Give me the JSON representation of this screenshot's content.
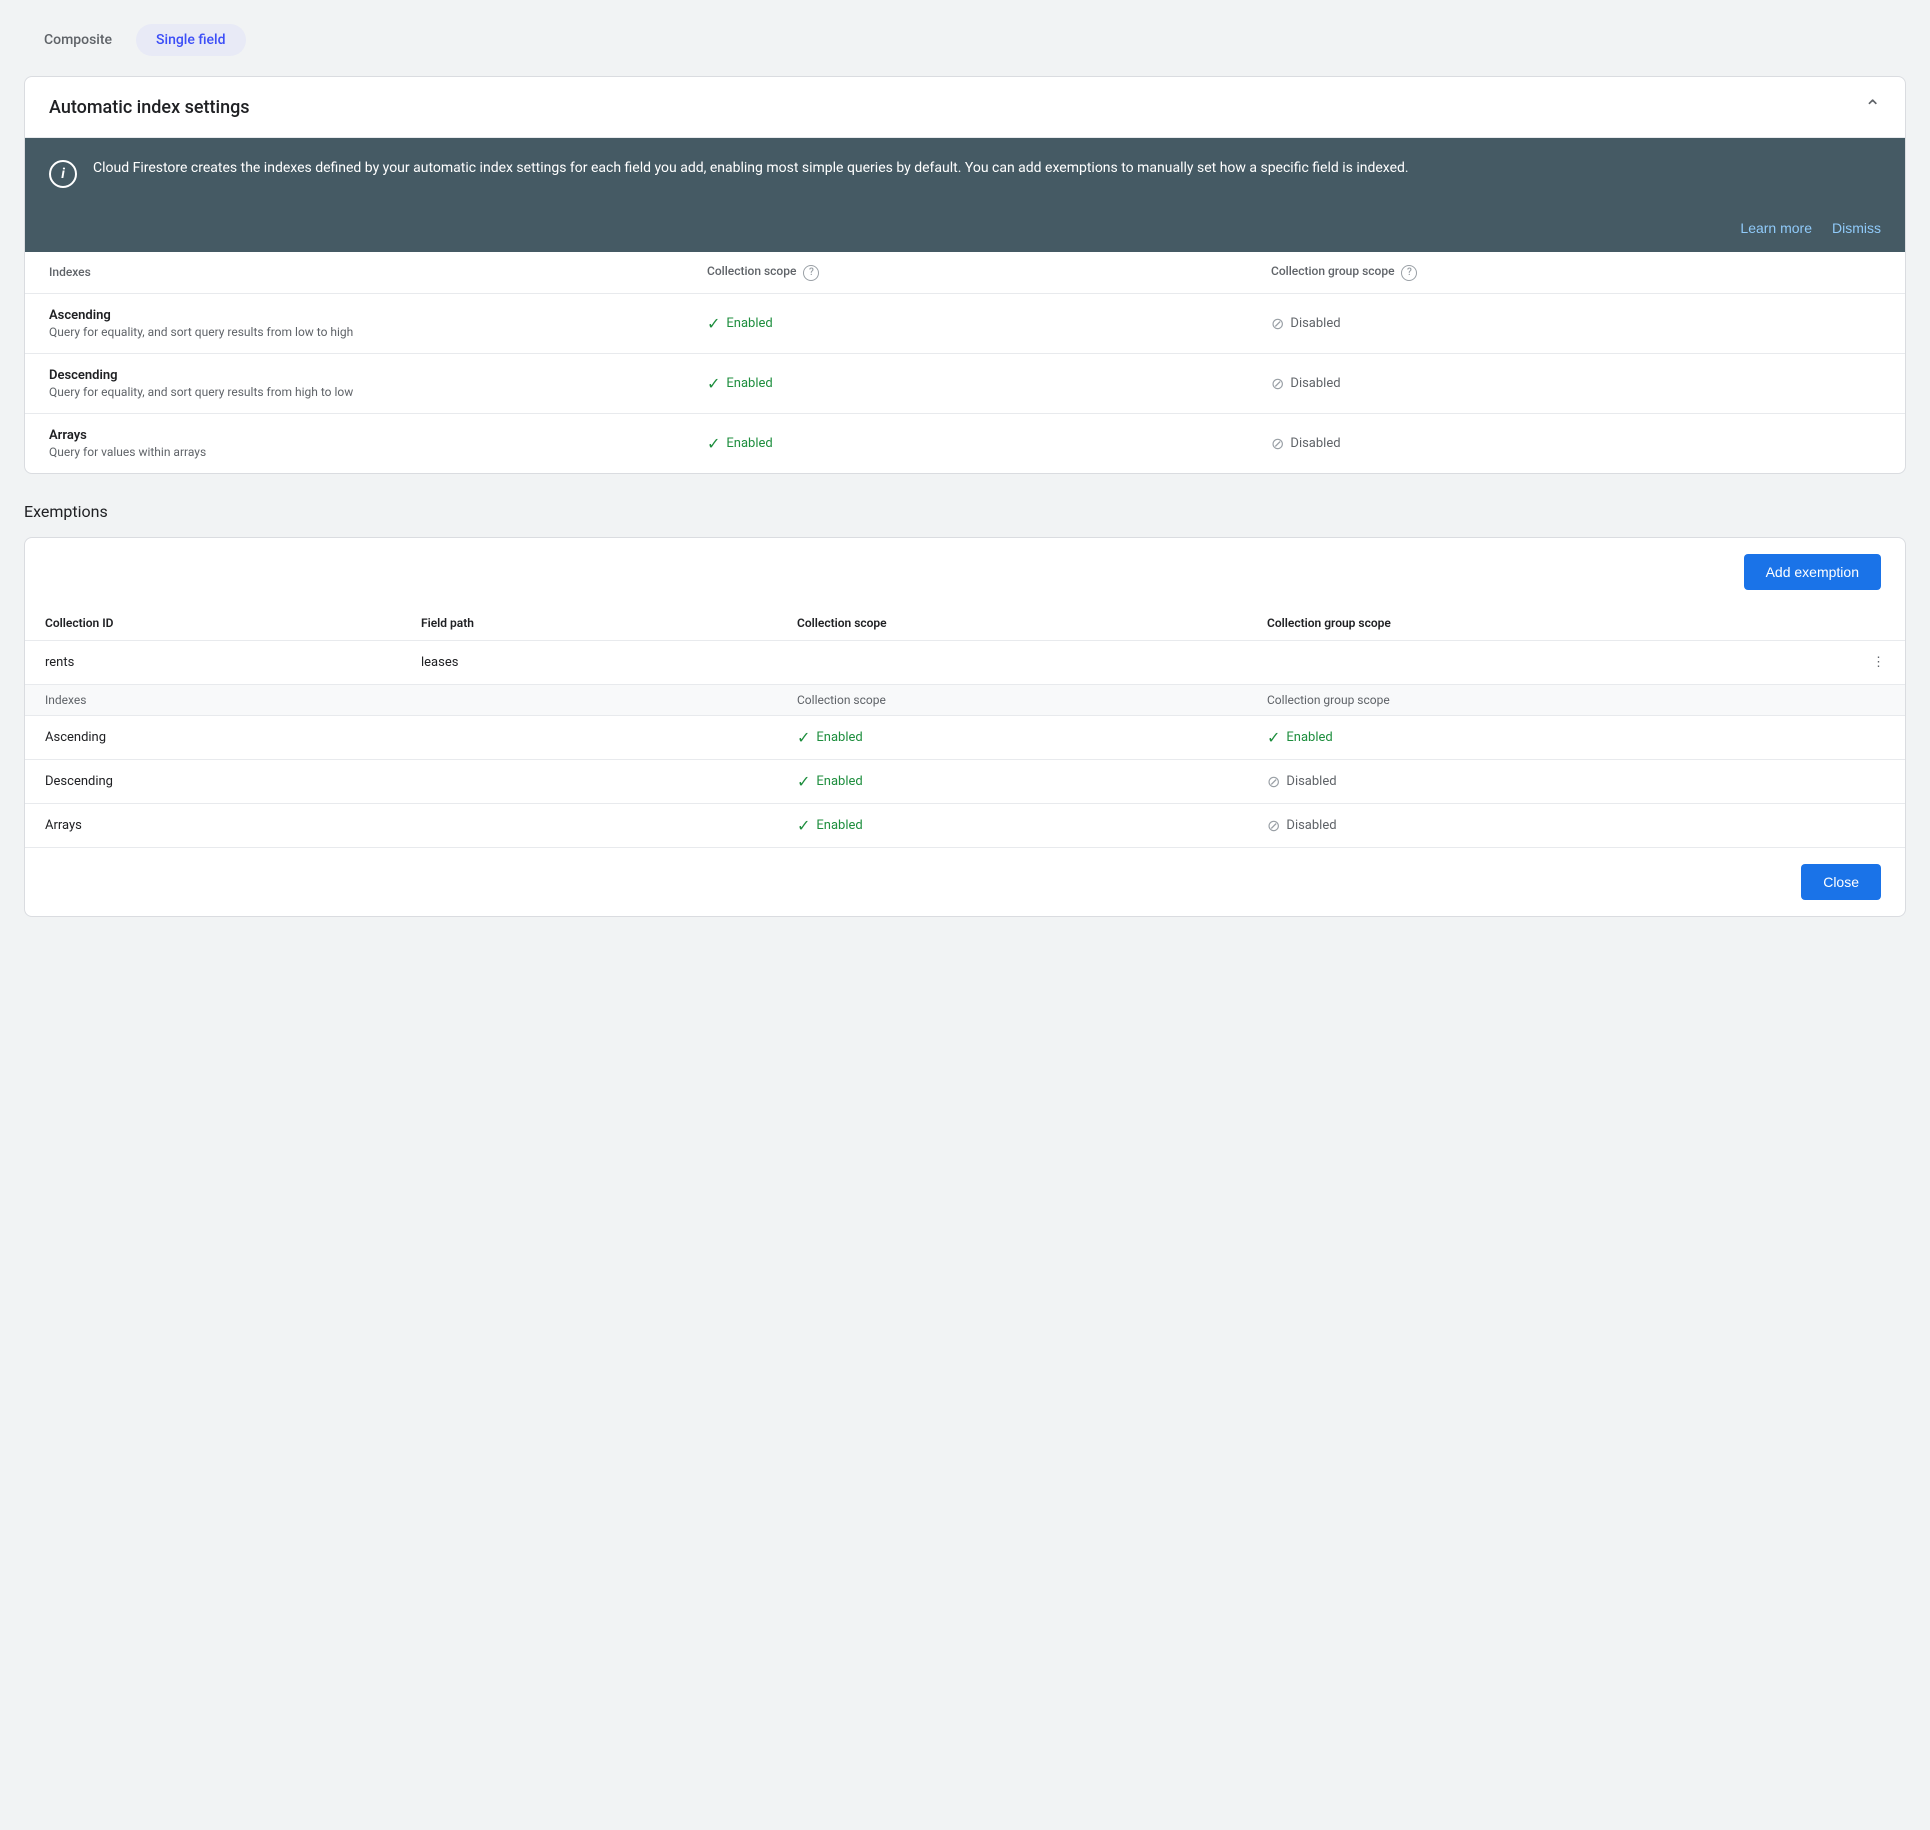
{
  "tabs": {
    "composite": {
      "label": "Composite",
      "active": false
    },
    "single_field": {
      "label": "Single field",
      "active": true
    }
  },
  "automatic_index": {
    "title": "Automatic index settings",
    "info_text": "Cloud Firestore creates the indexes defined by your automatic index settings for each field you add, enabling most simple queries by default. You can add exemptions to manually set how a specific field is indexed.",
    "learn_more": "Learn more",
    "dismiss": "Dismiss",
    "table": {
      "col_indexes": "Indexes",
      "col_collection": "Collection scope",
      "col_group": "Collection group scope",
      "rows": [
        {
          "name": "Ascending",
          "desc": "Query for equality, and sort query results from low to high",
          "collection_status": "Enabled",
          "group_status": "Disabled"
        },
        {
          "name": "Descending",
          "desc": "Query for equality, and sort query results from high to low",
          "collection_status": "Enabled",
          "group_status": "Disabled"
        },
        {
          "name": "Arrays",
          "desc": "Query for values within arrays",
          "collection_status": "Enabled",
          "group_status": "Disabled"
        }
      ]
    }
  },
  "exemptions": {
    "section_title": "Exemptions",
    "add_btn": "Add exemption",
    "col_collection_id": "Collection ID",
    "col_field_path": "Field path",
    "col_collection_scope": "Collection scope",
    "col_group_scope": "Collection group scope",
    "row": {
      "collection_id": "rents",
      "field_path": "leases"
    },
    "sub_table": {
      "col_indexes": "Indexes",
      "col_collection": "Collection scope",
      "col_group": "Collection group scope",
      "rows": [
        {
          "name": "Ascending",
          "collection_status": "Enabled",
          "group_status": "Enabled"
        },
        {
          "name": "Descending",
          "collection_status": "Enabled",
          "group_status": "Disabled"
        },
        {
          "name": "Arrays",
          "collection_status": "Enabled",
          "group_status": "Disabled"
        }
      ]
    }
  },
  "footer": {
    "close_btn": "Close"
  },
  "colors": {
    "enabled": "#1e8e3e",
    "disabled": "#5f6368",
    "accent": "#1a73e8",
    "banner_bg": "#455a64"
  }
}
